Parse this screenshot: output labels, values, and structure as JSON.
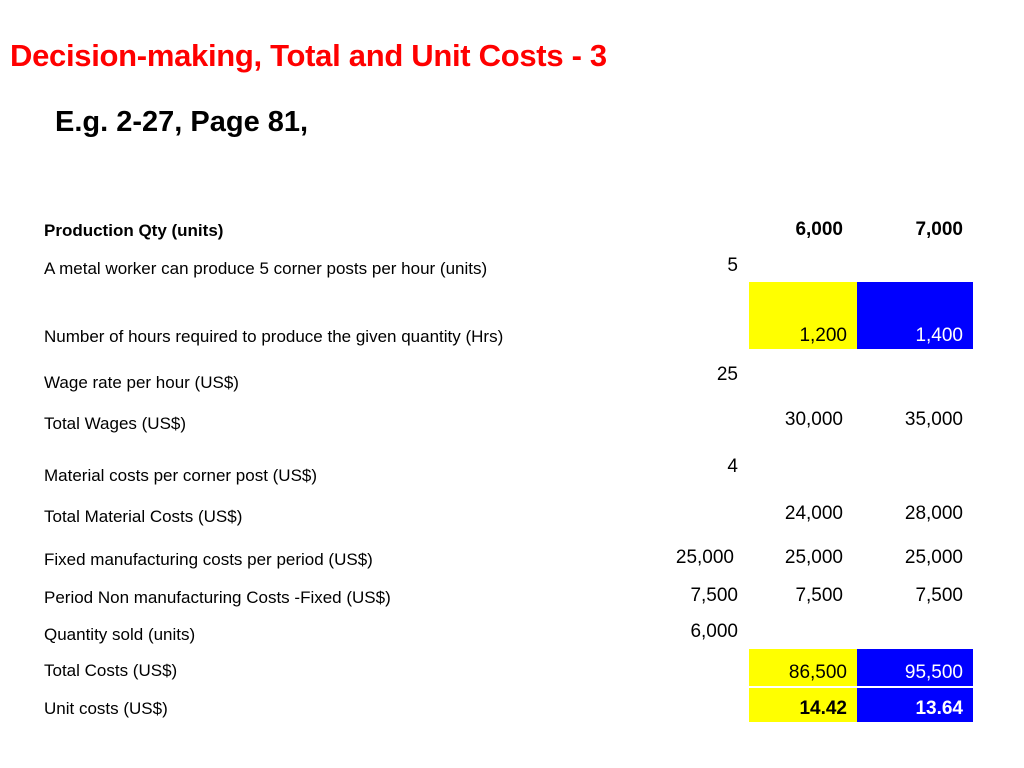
{
  "title": "Decision-making, Total and Unit Costs - 3",
  "subtitle": "E.g. 2-27, Page 81,",
  "rows": {
    "production_qty": {
      "label": "Production Qty (units)",
      "b": "6,000",
      "c": "7,000"
    },
    "posts_per_hour": {
      "label": "A metal worker can produce 5 corner posts per hour (units)",
      "a": "5"
    },
    "hours_required": {
      "label": "Number of hours required to produce the given quantity (Hrs)",
      "b": "1,200",
      "c": "1,400"
    },
    "wage_rate": {
      "label": "Wage rate per hour (US$)",
      "a": "25"
    },
    "total_wages": {
      "label": "Total Wages (US$)",
      "b": "30,000",
      "c": "35,000"
    },
    "material_cost": {
      "label": "Material costs per corner post (US$)",
      "a": "4"
    },
    "total_material": {
      "label": "Total Material Costs (US$)",
      "b": "24,000",
      "c": "28,000"
    },
    "fixed_mfg": {
      "label": "Fixed  manufacturing costs per period (US$)",
      "a": "25,000",
      "b": "25,000",
      "c": "25,000"
    },
    "non_mfg": {
      "label": "Period Non manufacturing Costs -Fixed (US$)",
      "a": "7,500",
      "b": "7,500",
      "c": "7,500"
    },
    "qty_sold": {
      "label": "Quantity sold (units)",
      "a": "6,000"
    },
    "total_costs": {
      "label": "Total Costs (US$)",
      "b": "86,500",
      "c": "95,500"
    },
    "unit_costs": {
      "label": "Unit costs (US$)",
      "b": "14.42",
      "c": "13.64"
    }
  },
  "colors": {
    "title": "#ff0000",
    "highlight_yellow": "#ffff00",
    "highlight_blue": "#0000ff"
  }
}
